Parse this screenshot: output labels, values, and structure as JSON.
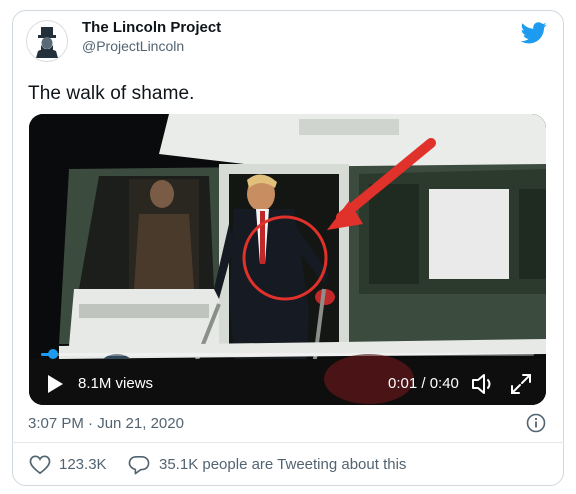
{
  "author": {
    "display_name": "The Lincoln Project",
    "handle": "@ProjectLincoln"
  },
  "tweet": {
    "text": "The walk of shame.",
    "timestamp": "3:07 PM · Jun 21, 2020"
  },
  "video": {
    "views": "8.1M views",
    "time": "0:01 / 0:40",
    "progress_fraction": 0.025
  },
  "actions": {
    "like_count": "123.3K",
    "reply_text": "35.1K people are Tweeting about this"
  },
  "colors": {
    "twitter_blue": "#1d9bf0",
    "secondary_text": "#536471",
    "annotation_red": "#e0312b"
  },
  "icons": [
    "twitter-bird-icon",
    "play-icon",
    "volume-icon",
    "fullscreen-icon",
    "info-icon",
    "heart-icon",
    "speech-bubble-icon"
  ]
}
